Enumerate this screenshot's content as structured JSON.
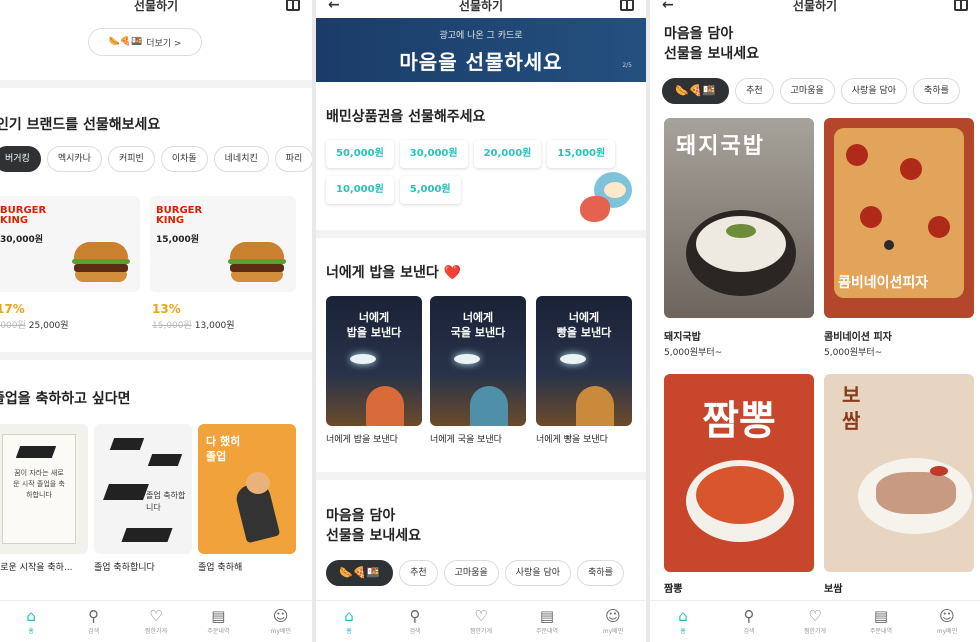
{
  "colors": {
    "accent": "#2ac1bc",
    "dark_chip": "#2f3235",
    "sale": "#f0a21e",
    "bk_red": "#d62300"
  },
  "header": {
    "title": "선물하기"
  },
  "panel1": {
    "more_label": "더보기 >",
    "brands_title": "인기 브랜드를 선물해보세요",
    "brand_chips": [
      "버거킹",
      "멕시카나",
      "커피빈",
      "이차돌",
      "네네치킨",
      "파리"
    ],
    "brand_cards": [
      {
        "logo_line1": "BURGER",
        "logo_line2": "KING",
        "price": "30,000원",
        "discount": "17%",
        "orig_price": "30,000원",
        "sale_price": "25,000원"
      },
      {
        "logo_line1": "BURGER",
        "logo_line2": "KING",
        "price": "15,000원",
        "discount": "13%",
        "orig_price": "15,000원",
        "sale_price": "13,000원"
      }
    ],
    "grad_title": "졸업을 축하하고 싶다면",
    "grad_cards": [
      {
        "caption": "새로운 시작을 축하...",
        "card_text": "꿈이 자라는 새로운 시작 졸업을 축하합니다"
      },
      {
        "caption": "졸업 축하합니다",
        "card_text": "졸업 축하합니다"
      },
      {
        "caption": "졸업 축하해",
        "card_text": "다 했히 졸업"
      }
    ]
  },
  "panel2": {
    "banner_sub": "광고에 나온 그 카드로",
    "banner_main": "마음을 선물하세요",
    "banner_pager": "2/5",
    "voucher_title": "배민상품권을 선물해주세요",
    "amounts": [
      "50,000원",
      "30,000원",
      "20,000원",
      "15,000원",
      "10,000원",
      "5,000원"
    ],
    "rice_title": "너에게 밥을 보낸다 ❤️",
    "rice_cards": [
      {
        "line1": "너에게",
        "line2": "밥을 보낸다",
        "caption": "너에게 밥을 보낸다"
      },
      {
        "line1": "너에게",
        "line2": "국을 보낸다",
        "caption": "너에게 국을 보낸다"
      },
      {
        "line1": "너에게",
        "line2": "빵을 보낸다",
        "caption": "너에게 빵을 보낸다"
      }
    ],
    "heart_title_line1": "마음을 담아",
    "heart_title_line2": "선물을 보내세요",
    "chips": [
      "🌭🍕🍱",
      "추천",
      "고마움을",
      "사랑을 담아",
      "축하를"
    ]
  },
  "panel3": {
    "title_line1": "마음을 담아",
    "title_line2": "선물을 보내세요",
    "chips": [
      "🌭🍕🍱",
      "추천",
      "고마움을",
      "사랑을 담아",
      "축하를"
    ],
    "foods": [
      {
        "name": "돼지국밥",
        "price": "5,000원부터~",
        "overlay": "돼지국밥"
      },
      {
        "name": "콤비네이션 피자",
        "price": "5,000원부터~",
        "overlay": "콤비네이션피자"
      },
      {
        "name": "짬뽕",
        "price": "",
        "overlay": "짬뽕"
      },
      {
        "name": "보쌈",
        "price": "",
        "overlay": "보쌈"
      }
    ]
  },
  "nav": [
    {
      "icon": "home-icon",
      "glyph": "⌂",
      "label": "홈"
    },
    {
      "icon": "search-icon",
      "glyph": "⚲",
      "label": "검색"
    },
    {
      "icon": "heart-icon",
      "glyph": "♡",
      "label": "찜한가게"
    },
    {
      "icon": "orders-icon",
      "glyph": "▤",
      "label": "주문내역"
    },
    {
      "icon": "my-icon",
      "glyph": "☺",
      "label": "my배민"
    }
  ]
}
